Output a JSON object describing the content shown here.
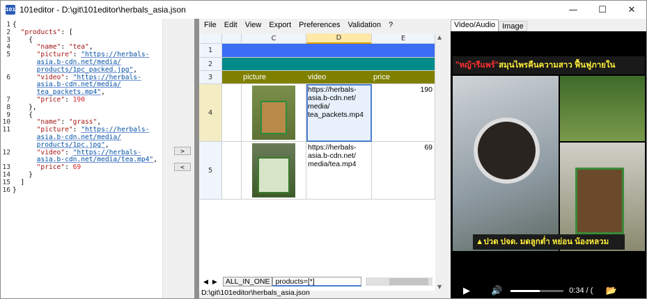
{
  "window": {
    "title": "101editor - D:\\git\\101editor\\herbals_asia.json",
    "icon_text": "101"
  },
  "code_lines": [
    {
      "n": "1",
      "html": "{"
    },
    {
      "n": "2",
      "html": "  <span class='k'>\"products\"</span>: ["
    },
    {
      "n": "3",
      "html": "    {"
    },
    {
      "n": "4",
      "html": "      <span class='k'>\"name\"</span>: <span class='k'>\"tea\"</span>,"
    },
    {
      "n": "5",
      "html": "      <span class='k'>\"picture\"</span>: <span class='s'>\"https://herbals-</span>"
    },
    {
      "n": "",
      "html": "      <span class='s'>asia.b-cdn.net/media/</span>"
    },
    {
      "n": "",
      "html": "      <span class='s'>products/1pc_packed.jpg\"</span>,"
    },
    {
      "n": "6",
      "html": "      <span class='k'>\"video\"</span>: <span class='s'>\"https://herbals-</span>"
    },
    {
      "n": "",
      "html": "      <span class='s'>asia.b-cdn.net/media/</span>"
    },
    {
      "n": "",
      "html": "      <span class='s'>tea_packets.mp4\"</span>,"
    },
    {
      "n": "7",
      "html": "      <span class='k'>\"price\"</span>: <span class='n'>190</span>"
    },
    {
      "n": "8",
      "html": "    },"
    },
    {
      "n": "9",
      "html": "    {"
    },
    {
      "n": "10",
      "html": "      <span class='k'>\"name\"</span>: <span class='k'>\"grass\"</span>,"
    },
    {
      "n": "11",
      "html": "      <span class='k'>\"picture\"</span>: <span class='s'>\"https://herbals-</span>"
    },
    {
      "n": "",
      "html": "      <span class='s'>asia.b-cdn.net/media/</span>"
    },
    {
      "n": "",
      "html": "      <span class='s'>products/1pc.jpg\"</span>,"
    },
    {
      "n": "12",
      "html": "      <span class='k'>\"video\"</span>: <span class='s'>\"https://herbals-</span>"
    },
    {
      "n": "",
      "html": "      <span class='s'>asia.b-cdn.net/media/tea.mp4\"</span>,"
    },
    {
      "n": "13",
      "html": "      <span class='k'>\"price\"</span>: <span class='n'>69</span>"
    },
    {
      "n": "14",
      "html": "    }"
    },
    {
      "n": "15",
      "html": "  ]"
    },
    {
      "n": "16",
      "html": "}"
    }
  ],
  "arrows": {
    "right": ">",
    "left": "<"
  },
  "menu": [
    "File",
    "Edit",
    "View",
    "Export",
    "Preferences",
    "Validation",
    "?"
  ],
  "grid": {
    "columns": [
      "C",
      "D",
      "E"
    ],
    "rows": [
      "1",
      "2",
      "3",
      "4",
      "5"
    ],
    "headers": {
      "picture": "picture",
      "video": "video",
      "price": "price"
    },
    "products": [
      {
        "video": "https://herbals-asia.b-cdn.net/media/tea_packets.mp4",
        "video_lines": [
          "https://herbals-",
          "asia.b-cdn.net/",
          "media/",
          "tea_packets.mp4"
        ],
        "price": "190"
      },
      {
        "video": "https://herbals-asia.b-cdn.net/media/tea.mp4",
        "video_lines": [
          "https://herbals-",
          "asia.b-cdn.net/",
          "media/tea.mp4"
        ],
        "price": "69"
      }
    ],
    "colors": {
      "row1": "#3b6ef5",
      "row2": "#008a8a",
      "row3": "#808000",
      "selected_border": "#4a7dcf"
    }
  },
  "sheet_tabs": {
    "tab1": "ALL_IN_ONE",
    "tab2": "products=[*]"
  },
  "status": "D:\\git\\101editor\\herbals_asia.json",
  "video": {
    "tabs": [
      "Video/Audio",
      "Image"
    ],
    "banner_title": "\"หญ้ารีแพร์\"",
    "banner_rest": " สมุนไพรคืนความสาว ฟื้นฟูภายใน",
    "warn_text": "▲ปวด ปจด. มดลูกต่ำ หย่อน น้องหลวม",
    "time": "0:34 / (",
    "progress": 0.55
  }
}
